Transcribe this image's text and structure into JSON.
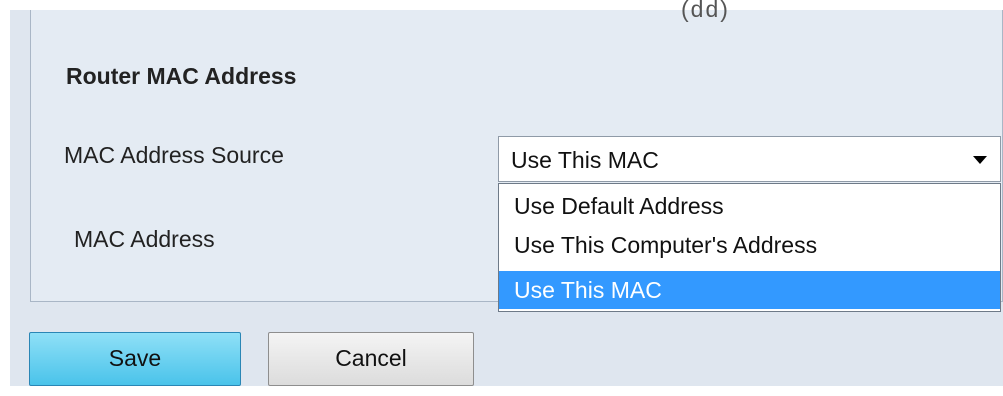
{
  "top_clipped_text": "(dd)",
  "section": {
    "title": "Router MAC Address"
  },
  "fields": {
    "mac_source_label": "MAC Address Source",
    "mac_address_label": "MAC Address"
  },
  "mac_source_select": {
    "selected": "Use This MAC",
    "options": [
      "Use Default Address",
      "Use This Computer's Address",
      "Use This MAC"
    ],
    "highlighted_index": 2,
    "highlight_color": "#3399ff"
  },
  "buttons": {
    "save": "Save",
    "cancel": "Cancel"
  },
  "colors": {
    "panel_background": "#e4ebf3",
    "save_button": "#4ac3ea"
  }
}
